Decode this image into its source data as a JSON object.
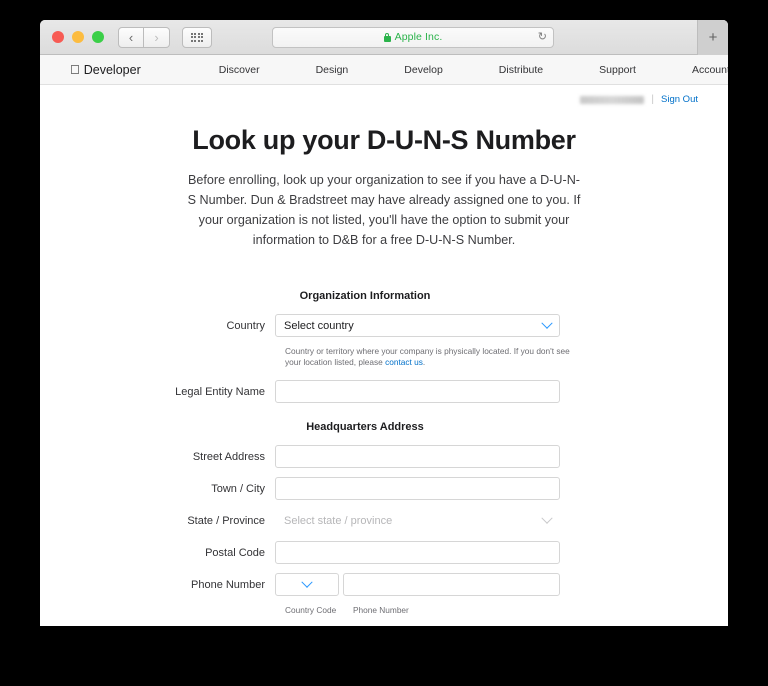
{
  "browser": {
    "address": {
      "site_name": "Apple Inc.",
      "lock_icon": "lock-icon",
      "reload_icon": "↻"
    },
    "back_icon": "‹",
    "forward_icon": "›",
    "tabs_icon": "grid-icon",
    "new_tab_icon": "+"
  },
  "site_nav": {
    "brand_glyph": "",
    "brand": "Developer",
    "links": [
      {
        "label": "Discover"
      },
      {
        "label": "Design"
      },
      {
        "label": "Develop"
      },
      {
        "label": "Distribute"
      },
      {
        "label": "Support"
      },
      {
        "label": "Account"
      }
    ],
    "search_icon": "search-icon"
  },
  "account_bar": {
    "username_redacted": "",
    "divider": "|",
    "sign_out": "Sign Out"
  },
  "page": {
    "headline": "Look up your D-U-N-S Number",
    "intro": "Before enrolling, look up your organization to see if you have a D-U-N-S Number. Dun & Bradstreet may have already assigned one to you. If your organization is not listed, you'll have the option to submit your information to D&B for a free D-U-N-S Number."
  },
  "form": {
    "org_section_title": "Organization Information",
    "country": {
      "label": "Country",
      "placeholder": "Select country",
      "value": "Select country",
      "helper_prefix": "Country or territory where your company is physically located. If you don't see your location listed, please ",
      "helper_link": "contact us",
      "helper_suffix": "."
    },
    "legal_entity": {
      "label": "Legal Entity Name",
      "value": "",
      "placeholder": ""
    },
    "hq_section_title": "Headquarters Address",
    "street": {
      "label": "Street Address",
      "value": "",
      "placeholder": ""
    },
    "town": {
      "label": "Town / City",
      "value": "",
      "placeholder": ""
    },
    "state": {
      "label": "State / Province",
      "value": "Select state / province",
      "placeholder": "Select state / province"
    },
    "postal": {
      "label": "Postal Code",
      "value": "",
      "placeholder": ""
    },
    "phone": {
      "label": "Phone Number",
      "country_code_value": "",
      "number_value": "",
      "number_placeholder": "",
      "sub_label_code": "Country Code",
      "sub_label_number": "Phone Number"
    }
  },
  "colors": {
    "accent_blue": "#2997ff",
    "link_blue": "#0070c9",
    "secure_green": "#2bb34b",
    "text_dark": "#1d1d1f"
  }
}
